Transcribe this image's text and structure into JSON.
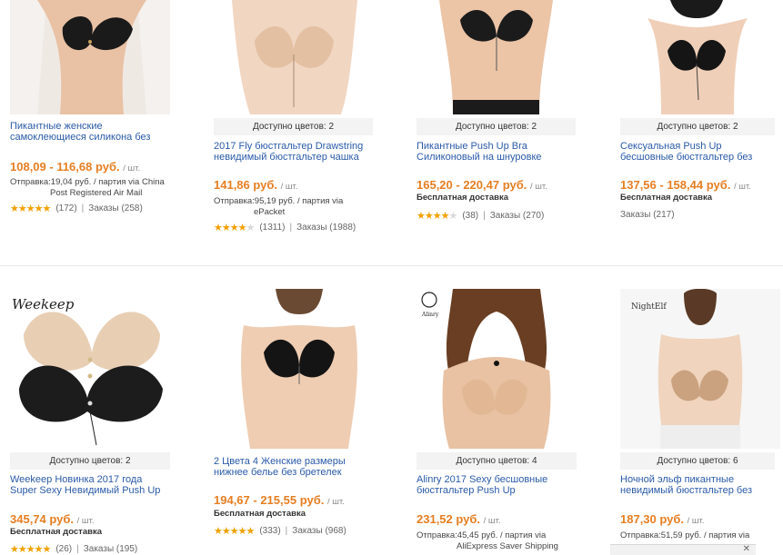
{
  "products_row1": [
    {
      "colors": "",
      "title": [
        "Пикантные женские",
        "самоклеющиеся силикона без"
      ],
      "price": "108,09 - 116,68 руб.",
      "unit": "/ шт.",
      "shipping": [
        "Отправка:19,04 руб. / партия via China",
        "Post Registered Air Mail"
      ],
      "free_shipping": "",
      "stars": 5,
      "reviews": "(172)",
      "orders": "Заказы (258)"
    },
    {
      "colors": "Доступно цветов: 2",
      "title": [
        "2017 Fly бюстгальтер Drawstring",
        "невидимый бюстгальтер чашка"
      ],
      "price": "141,86 руб.",
      "unit": "/ шт.",
      "shipping": [
        "Отправка:95,19 руб. / партия via",
        "ePacket"
      ],
      "free_shipping": "",
      "stars": 4.5,
      "reviews": "(1311)",
      "orders": "Заказы (1988)"
    },
    {
      "colors": "Доступно цветов: 2",
      "title": [
        "Пикантные Push Up Bra",
        "Силиконовый на шнуровке"
      ],
      "price": "165,20 - 220,47 руб.",
      "unit": "/ шт.",
      "shipping": [],
      "free_shipping": "Бесплатная доставка",
      "stars": 4.5,
      "reviews": "(38)",
      "orders": "Заказы (270)"
    },
    {
      "colors": "Доступно цветов: 2",
      "title": [
        "Сексуальная Push Up",
        "бесшовные бюстгальтер без"
      ],
      "price": "137,56 - 158,44 руб.",
      "unit": "/ шт.",
      "shipping": [],
      "free_shipping": "Бесплатная доставка",
      "stars": 0,
      "reviews": "",
      "orders": "Заказы (217)"
    }
  ],
  "products_row2": [
    {
      "colors": "Доступно цветов: 2",
      "brand": "Weekeep",
      "title": [
        "Weekeep Новинка 2017 года",
        "Super Sexy Невидимый Push Up"
      ],
      "price": "345,74 руб.",
      "unit": "/ шт.",
      "shipping": [],
      "free_shipping": "Бесплатная доставка",
      "stars": 5,
      "reviews": "(26)",
      "orders": "Заказы (195)"
    },
    {
      "colors": "",
      "title": [
        "2 Цвета 4 Женские размеры",
        "нижнее белье без бретелек"
      ],
      "price": "194,67 - 215,55 руб.",
      "unit": "/ шт.",
      "shipping": [],
      "free_shipping": "Бесплатная доставка",
      "stars": 5,
      "reviews": "(333)",
      "orders": "Заказы (968)"
    },
    {
      "colors": "Доступно цветов: 4",
      "brand": "Alinry",
      "title": [
        "Alinry 2017 Sexy бесшовные",
        "бюстгальтер Push Up"
      ],
      "price": "231,52 руб.",
      "unit": "/ шт.",
      "shipping": [
        "Отправка:45,45 руб. / партия via",
        "AliExpress Saver Shipping"
      ],
      "free_shipping": "",
      "stars": 0,
      "reviews": "",
      "orders": ""
    },
    {
      "colors": "Доступно цветов: 6",
      "brand": "NightElf",
      "title": [
        "Ночной эльф пикантные",
        "невидимый бюстгальтер без"
      ],
      "price": "187,30 руб.",
      "unit": "/ шт.",
      "shipping": [
        "Отправка:51,59 руб. / партия via"
      ],
      "free_shipping": "",
      "stars": 0,
      "reviews": "",
      "orders": ""
    }
  ],
  "colors": {
    "price": "#e67e22",
    "title_link": "#2a5aa8",
    "star": "#f0a000",
    "colors_bar": "#f3f3f3"
  }
}
